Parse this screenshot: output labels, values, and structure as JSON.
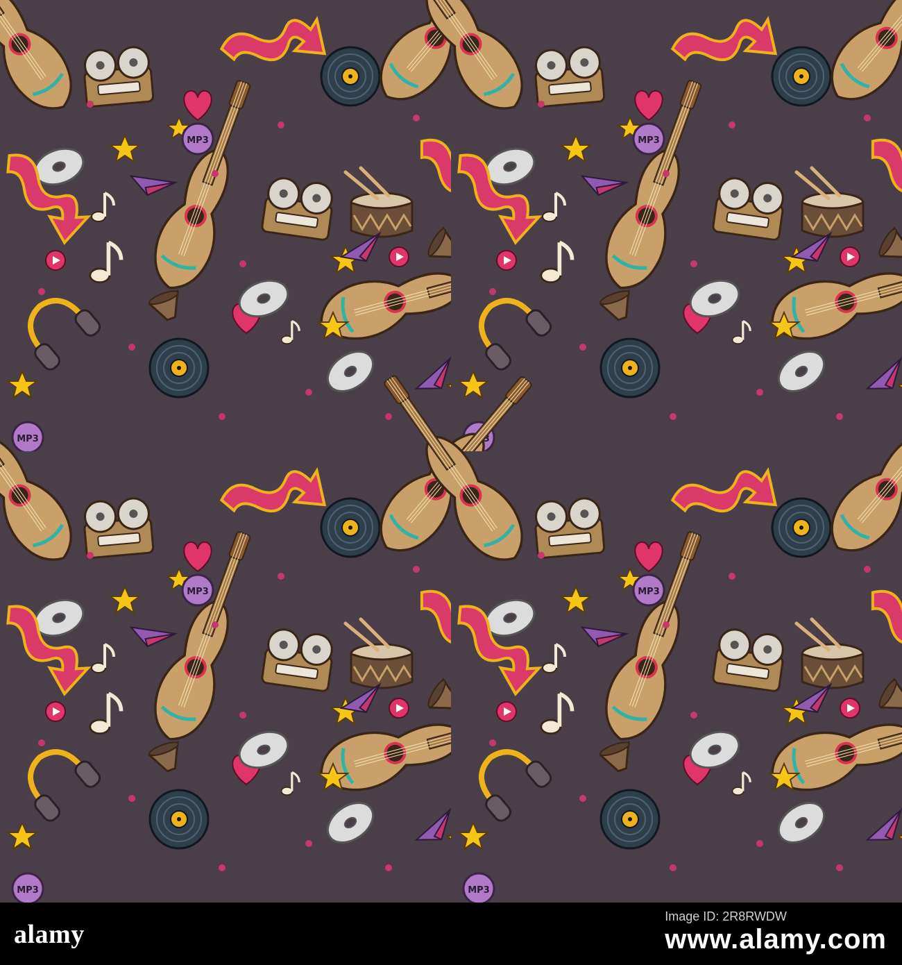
{
  "artwork": {
    "background_color": "#4a3e49",
    "tile_layout": "2x2 seamless repeat",
    "motifs": [
      "guitar-icon",
      "vinyl-record-icon",
      "reel-tape-recorder-icon",
      "drum-icon",
      "headphones-icon",
      "cd-disc-icon",
      "mp3-button-icon",
      "star-icon",
      "heart-icon",
      "zigzag-arrow-icon",
      "music-note-icon",
      "horn-speaker-icon",
      "paper-plane-icon",
      "play-button-icon"
    ],
    "colors": {
      "guitar": "#c9a06a",
      "guitar_outline": "#3a2616",
      "vinyl": "#2e3e4a",
      "reel": "#d9d4cc",
      "star": "#f5c518",
      "heart": "#e0356a",
      "zigzag": "#d93a6a",
      "arrow_yellow": "#f0b21b",
      "drum": "#6b4e37",
      "headphones": "#6a5c64",
      "cd": "#dcdcdc",
      "purple": "#8f5ab0"
    },
    "labels": {
      "mp3": "MP3"
    }
  },
  "footer": {
    "logo": "alamy",
    "caption": "Image ID: 2R8RWDW",
    "image_id": "www.alamy.com"
  }
}
